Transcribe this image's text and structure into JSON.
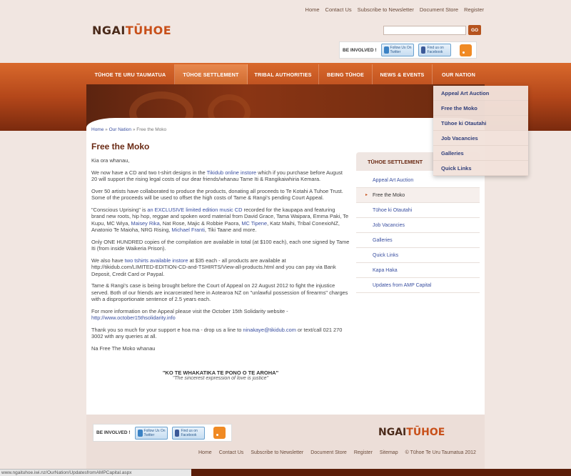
{
  "top_links": [
    "Home",
    "Contact Us",
    "Subscribe to Newsletter",
    "Document Store",
    "Register"
  ],
  "logo": {
    "part1": "NGAI",
    "part2": "TŪHOE"
  },
  "search": {
    "value": "",
    "go_label": "GO"
  },
  "social": {
    "involved": "BE INVOLVED !",
    "twitter": "Follow Us On Twitter",
    "facebook": "Find us on Facebook"
  },
  "nav": [
    "TŪHOE TE URU TAUMATUA",
    "TŪHOE SETTLEMENT",
    "TRIBAL AUTHORITIES",
    "BEING TŪHOE",
    "NEWS & EVENTS",
    "OUR NATION"
  ],
  "dropdown": [
    "Appeal Art Auction",
    "Free the Moko",
    "Tūhoe ki Otautahi",
    "Job Vacancies",
    "Galleries",
    "Quick Links"
  ],
  "breadcrumb": {
    "home": "Home",
    "sep": " » ",
    "section": "Our Nation",
    "current": "Free the Moko"
  },
  "page_title": "Free the Moko",
  "body": {
    "p1": "Kia ora whanau,",
    "p2a": "We now have a CD and two t-shirt designs in the ",
    "p2link": "Tikidub online instore",
    "p2b": " which if you purchase before August 20 will support the rising legal costs of our dear friends/whanau Tame Iti & Rangikaiwhiria Kemara.",
    "p3": "Over 50 artists have collaborated to produce the products, donating all proceeds to Te Kotahi A Tuhoe Trust. Some of the proceeds will be used to offset the high costs of Tame & Rangi's pending Court Appeal.",
    "p4a": "\"Conscious Uprising\" is an ",
    "p4link": "an EXCLUSIVE limited edition music CD",
    "p4b": " recorded for the kaupapa and featuring brand new roots, hip hop, reggae and spoken word material from David Grace, Tama Waipara, Emma Paki, Te Kupu, MC Wiya, ",
    "p4link2": "Maisey Rika",
    "p4c": ", Nat Rose, Majic & Robbie Paora, ",
    "p4link3": "MC Tipene",
    "p4d": ", Katz Maihi, Tribal ConexioNZ, Anatonio Te Maioha, NRG Rising, ",
    "p4link4": "Michael Franti",
    "p4e": ", Tiki Taane and more.",
    "p5": "Only ONE HUNDRED copies of the compilation are available in total (at $100 each), each one signed by Tame Iti (from inside Waikeria Prison).",
    "p6a": "We also have ",
    "p6link": "two tshirts available instore",
    "p6b": " at $35 each - all products are available at http://tikidub.com/LIMITED-EDITION-CD-and-TSHIRTS/View-all-products.html and you can pay via Bank Deposit, Credit Card or Paypal.",
    "p7": "Tame & Rangi's case is being brought before the Court of Appeal on 22 August 2012 to fight the injustice served. Both of our friends are incarcerated here in Aotearoa NZ on \"unlawful possession of firearms\" charges with a disproportionate sentence of 2.5 years each.",
    "p8a": "For more information on the Appeal please visit the October 15th Solidarity website - ",
    "p8link": "http://www.october15thsolidarity.info",
    "p9a": "Thank you so much for your support e hoa ma - drop us a line to ",
    "p9link": "ninakaye@tikidub.com",
    "p9b": " or text/call 021 270 3002 with any queries at all.",
    "p10": "Na Free The Moko whanau"
  },
  "quote": {
    "line1": "\"KO TE WHAKATIKA TE PONO O TE AROHA\"",
    "line2": "\"The sincerest expression of love is justice\""
  },
  "sidebar": {
    "heading": "TŪHOE SETTLEMENT",
    "items": [
      "Appeal Art Auction",
      "Free the Moko",
      "Tūhoe ki Otautahi",
      "Job Vacancies",
      "Galleries",
      "Quick Links",
      "Kapa Haka",
      "Updates from AMP Capital"
    ]
  },
  "footer": {
    "links": [
      "Home",
      "Contact Us",
      "Subscribe to Newsletter",
      "Document Store",
      "Register",
      "Sitemap",
      "© Tūhoe Te Uru Taumatua 2012"
    ]
  },
  "status_url": "www.ngaituhoe.iwi.nz/OurNation/UpdatesfromAMPCapital.aspx",
  "colors": {
    "accent": "#c8501a",
    "link": "#3a4fa0",
    "title": "#6a2a14"
  }
}
